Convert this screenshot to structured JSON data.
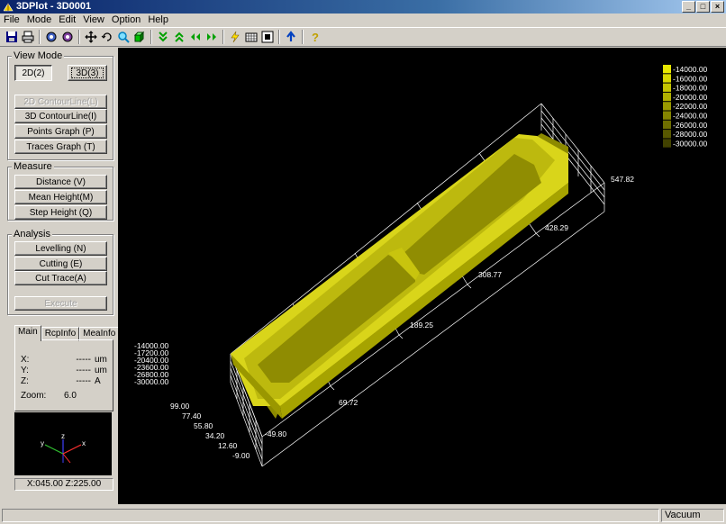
{
  "window": {
    "title": "3DPlot - 3D0001",
    "buttons": {
      "minimize": "_",
      "maximize": "□",
      "close": "×"
    }
  },
  "menu": [
    "File",
    "Mode",
    "Edit",
    "View",
    "Option",
    "Help"
  ],
  "toolbar": {
    "icons": [
      "save-icon",
      "print-icon",
      "settings-icon",
      "settings-alt-icon",
      "pan-icon",
      "rotate-icon",
      "zoom-icon",
      "box-view-icon",
      "move-down-icon",
      "move-up-icon",
      "move-left-icon",
      "move-right-icon",
      "lightning-icon",
      "grid-icon",
      "frame-icon",
      "reset-icon",
      "help-icon"
    ]
  },
  "left_panel": {
    "view_mode": {
      "label": "View Mode",
      "btn_2d": "2D(2)",
      "btn_3d": "3D(3)",
      "btn_2d_contour": "2D ContourLine(L)",
      "btn_3d_contour": "3D ContourLine(I)",
      "btn_points": "Points Graph   (P)",
      "btn_traces": "Traces Graph   (T)"
    },
    "measure": {
      "label": "Measure",
      "btn_distance": "Distance     (V)",
      "btn_mean_height": "Mean Height(M)",
      "btn_step_height": "Step Height  (Q)"
    },
    "analysis": {
      "label": "Analysis",
      "btn_levelling": "Levelling   (N)",
      "btn_cutting": "Cutting     (E)",
      "btn_cut_trace": "Cut Trace(A)",
      "btn_execute": "Execute"
    },
    "tabs": [
      "Main",
      "RcpInfo",
      "MeaInfo"
    ],
    "info": {
      "x_label": "X:",
      "x_value": "-----",
      "x_unit": "um",
      "y_label": "Y:",
      "y_value": "-----",
      "y_unit": "um",
      "z_label": "Z:",
      "z_value": "-----",
      "z_unit": "A",
      "zoom_label": "Zoom:",
      "zoom_value": "6.0"
    },
    "axis_labels": {
      "x": "x",
      "y": "y",
      "z": "z"
    },
    "angle": "X:045.00   Z:225.00"
  },
  "plot": {
    "legend": [
      "-14000.00",
      "-16000.00",
      "-18000.00",
      "-20000.00",
      "-22000.00",
      "-24000.00",
      "-26000.00",
      "-28000.00",
      "-30000.00"
    ],
    "legend_colors": [
      "#e6e600",
      "#d6d600",
      "#c4c400",
      "#b0b000",
      "#9a9a00",
      "#858500",
      "#6e6e00",
      "#585800",
      "#424200"
    ],
    "z_ticks": [
      "-14000.00",
      "-17200.00",
      "-20400.00",
      "-23600.00",
      "-26800.00",
      "-30000.00"
    ],
    "x_ticks": [
      "69.72",
      "189.25",
      "308.77",
      "428.29",
      "547.82"
    ],
    "y_ticks": [
      "99.00",
      "77.40",
      "55.80",
      "34.20",
      "12.60",
      "-9.00",
      "-49.80"
    ],
    "surface_color": "#e0dc10"
  },
  "status": {
    "cell1": "",
    "cell2": "Vacuum"
  }
}
